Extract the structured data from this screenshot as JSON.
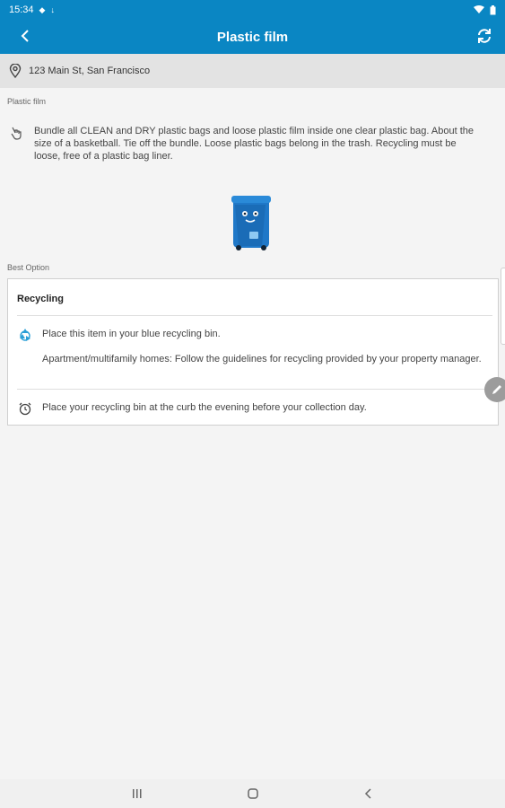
{
  "status_bar": {
    "time": "15:34",
    "icons": [
      "notification-icon",
      "download-icon",
      "wifi-icon",
      "battery-icon"
    ]
  },
  "app_bar": {
    "title": "Plastic film",
    "back_icon": "back-arrow-icon",
    "refresh_icon": "refresh-icon"
  },
  "address": {
    "icon": "location-pin-icon",
    "text": "123 Main St, San Francisco"
  },
  "item": {
    "section_label": "Plastic film",
    "description_icon": "hand-pointing-icon",
    "description": "Bundle all CLEAN and DRY plastic bags and loose plastic film inside one clear plastic bag. About the size of a basketball. Tie off the bundle. Loose plastic bags belong in the trash. Recycling must be loose, free of a plastic bag liner."
  },
  "best_option": {
    "section_label": "Best Option",
    "card_title": "Recycling",
    "instruction_icon": "recycle-icon",
    "instruction": "Place this item in your blue recycling bin.",
    "note": "Apartment/multifamily homes: Follow the guidelines for recycling provided by your property manager.",
    "schedule_icon": "alarm-clock-icon",
    "schedule": "Place your recycling bin at the curb the evening before your collection day."
  },
  "colors": {
    "primary": "#0a86c3",
    "bin_blue": "#1f78c8",
    "recycle_icon": "#2a9fd6"
  },
  "nav_bar": {
    "icons": [
      "recent-apps-icon",
      "home-icon",
      "back-icon"
    ]
  }
}
